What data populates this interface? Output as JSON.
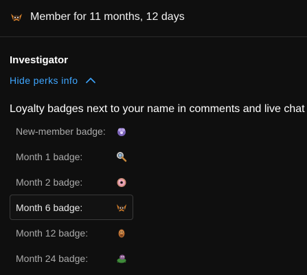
{
  "header": {
    "title": "Member for 11 months, 12 days",
    "icon": "fox-member-badge-icon"
  },
  "level": {
    "name": "Investigator"
  },
  "perks_toggle": {
    "label": "Hide perks info",
    "icon": "chevron-up-icon"
  },
  "badges_section": {
    "heading": "Loyalty badges next to your name in comments and live chat",
    "items": [
      {
        "label": "New-member badge:",
        "icon": "purple-cloud-badge-icon",
        "selected": false
      },
      {
        "label": "Month 1 badge:",
        "icon": "magnifier-badge-icon",
        "selected": false
      },
      {
        "label": "Month 2 badge:",
        "icon": "pink-donut-badge-icon",
        "selected": false
      },
      {
        "label": "Month 6 badge:",
        "icon": "fox-badge-icon",
        "selected": true
      },
      {
        "label": "Month 12 badge:",
        "icon": "brown-figure-badge-icon",
        "selected": false
      },
      {
        "label": "Month 24 badge:",
        "icon": "green-creature-badge-icon",
        "selected": false
      }
    ]
  },
  "colors": {
    "background": "#0f0f0f",
    "link_blue": "#3ea6ff",
    "muted_text": "#aaaaaa"
  }
}
